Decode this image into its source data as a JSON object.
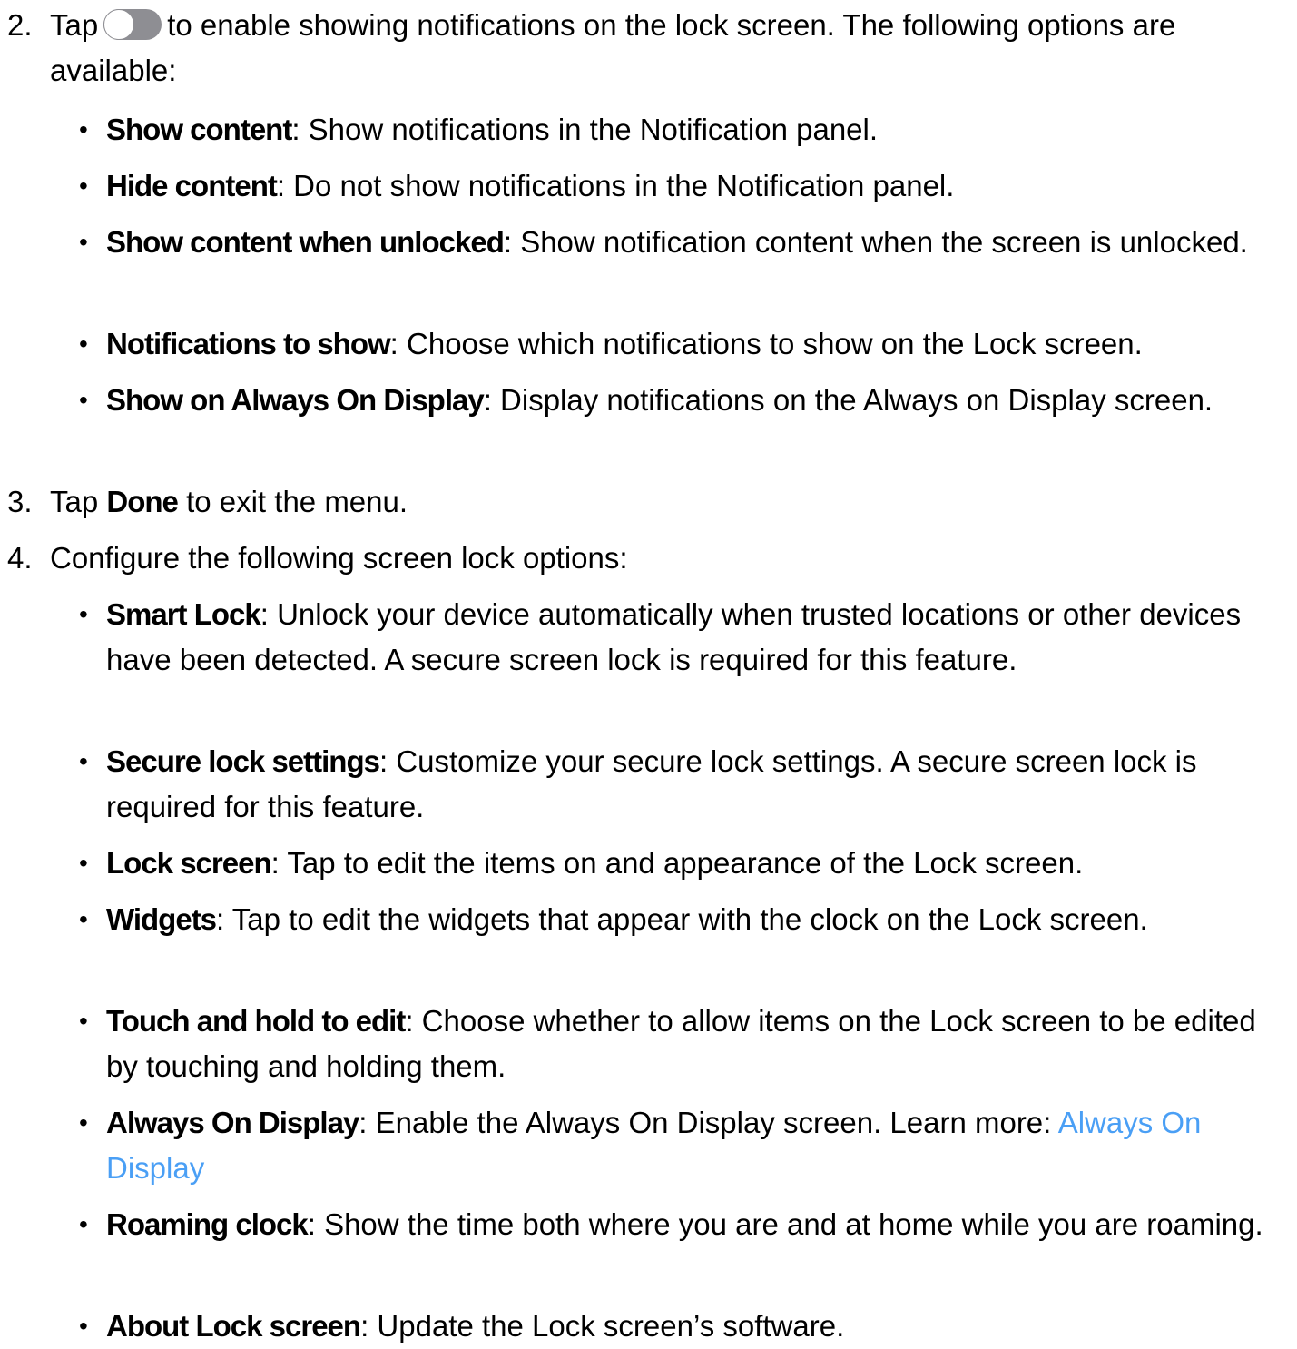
{
  "steps": [
    {
      "number": "2.",
      "text_before": "Tap",
      "toggle_icon": "toggle-off-icon",
      "text_after": "to enable showing notifications on the lock screen. The following options are available:",
      "items": [
        {
          "term": "Show content",
          "desc": ": Show notifications in the Notification panel."
        },
        {
          "term": "Hide content",
          "desc": ": Do not show notifications in the Notification panel."
        },
        {
          "term": "Show content when unlocked",
          "desc": ": Show notification content when the screen is unlocked."
        },
        {
          "term": "Notifications to show",
          "desc": ": Choose which notifications to show on the Lock screen."
        },
        {
          "term": "Show on Always On Display",
          "desc": ": Display notifications on the Always on Display screen."
        }
      ]
    },
    {
      "number": "3.",
      "text_before": "Tap",
      "bold": "Done",
      "text_after": "to exit the menu."
    },
    {
      "number": "4.",
      "text": "Configure the following screen lock options:",
      "items": [
        {
          "term": "Smart Lock",
          "desc": ": Unlock your device automatically when trusted locations or other devices have been detected. A secure screen lock is required for this feature."
        },
        {
          "term": "Secure lock settings",
          "desc": ": Customize your secure lock settings. A secure screen lock is required for this feature."
        },
        {
          "term": "Lock screen",
          "desc": ": Tap to edit the items on and appearance of the Lock screen."
        },
        {
          "term": "Widgets",
          "desc": ": Tap to edit the widgets that appear with the clock on the Lock screen."
        },
        {
          "term": "Touch and hold to edit",
          "desc": ": Choose whether to allow items on the Lock screen to be edited by touching and holding them."
        },
        {
          "term": "Always On Display",
          "desc": ": Enable the Always On Display screen. Learn more: ",
          "link": "Always On Display"
        },
        {
          "term": "Roaming clock",
          "desc": ": Show the time both where you are and at home while you are roaming."
        },
        {
          "term": "About Lock screen",
          "desc": ": Update the Lock screen’s software."
        }
      ]
    }
  ],
  "bullet_symbol": "•",
  "colors": {
    "text": "#000000",
    "link": "#4a9ff5",
    "toggle_track": "#8e8e93"
  }
}
